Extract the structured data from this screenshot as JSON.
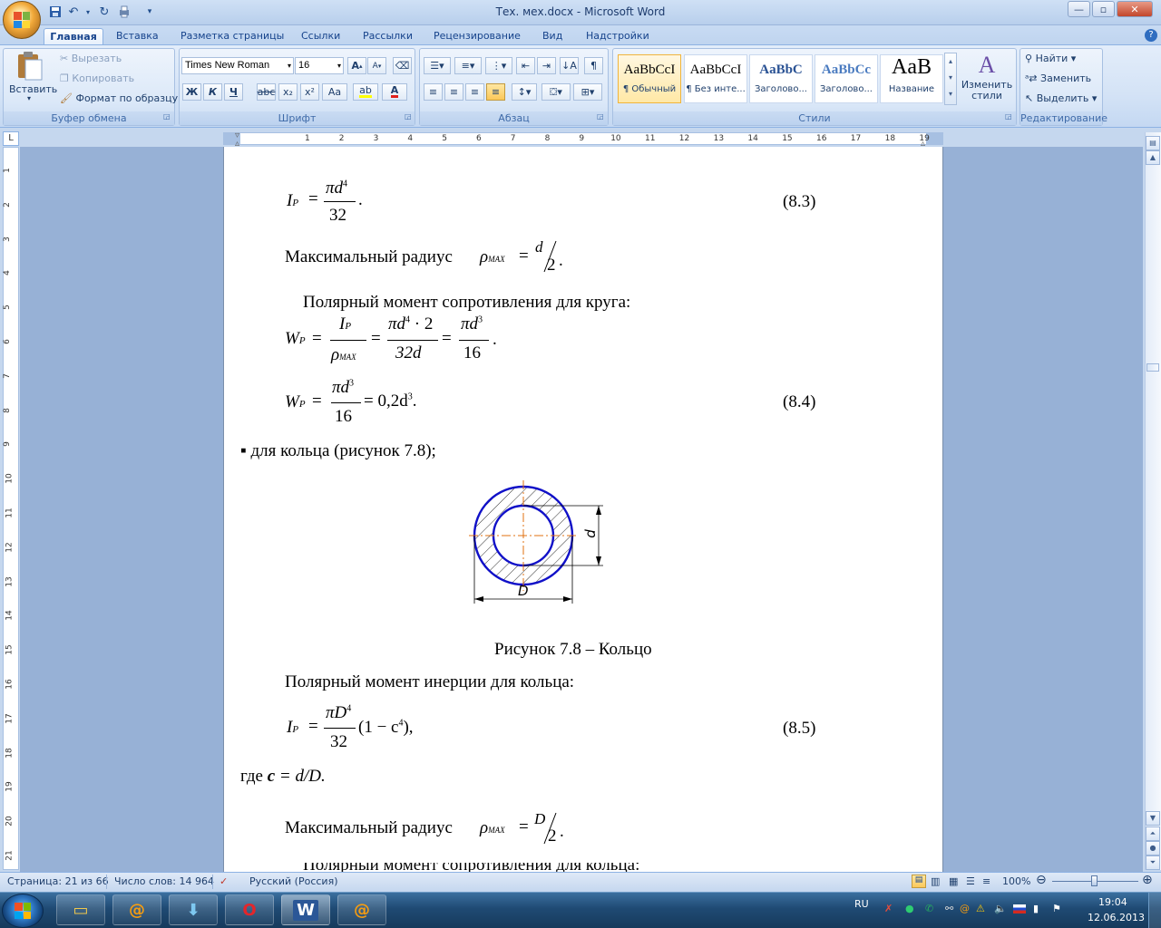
{
  "window": {
    "title": "Тех. мех.docx - Microsoft Word"
  },
  "tabs": [
    "Главная",
    "Вставка",
    "Разметка страницы",
    "Ссылки",
    "Рассылки",
    "Рецензирование",
    "Вид",
    "Надстройки"
  ],
  "clipboard": {
    "paste": "Вставить",
    "cut": "Вырезать",
    "copy": "Копировать",
    "format_painter": "Формат по образцу",
    "label": "Буфер обмена"
  },
  "font": {
    "name": "Times New Roman",
    "size": "16",
    "label": "Шрифт",
    "bold": "Ж",
    "italic": "К",
    "underline": "Ч",
    "strike": "abc",
    "subscript": "x₂",
    "superscript": "x²",
    "case": "Aa",
    "grow": "A",
    "shrink": "A"
  },
  "paragraph": {
    "label": "Абзац"
  },
  "styles": {
    "label": "Стили",
    "items": [
      {
        "sample": "AaBbCcI",
        "name": "¶ Обычный"
      },
      {
        "sample": "AaBbCcI",
        "name": "¶ Без инте..."
      },
      {
        "sample": "AaBbC",
        "name": "Заголово..."
      },
      {
        "sample": "AaBbCc",
        "name": "Заголово..."
      },
      {
        "sample": "AaB",
        "name": "Название"
      }
    ],
    "change": "Изменить стили"
  },
  "editing": {
    "find": "Найти",
    "replace": "Заменить",
    "select": "Выделить",
    "label": "Редактирование"
  },
  "ruler": {
    "h_numbers": [
      "1",
      "2",
      "3",
      "4",
      "5",
      "6",
      "7",
      "8",
      "9",
      "10",
      "11",
      "12",
      "13",
      "14",
      "15",
      "16",
      "17",
      "18",
      "19"
    ],
    "v_numbers": [
      "1",
      "2",
      "3",
      "4",
      "5",
      "6",
      "7",
      "8",
      "9",
      "10",
      "11",
      "12",
      "13",
      "14",
      "15",
      "16",
      "17",
      "18",
      "19",
      "20",
      "21"
    ]
  },
  "document": {
    "eq83_lhs": "I",
    "eq83_sub": "P",
    "eq83_num": "πd",
    "eq83_exp": "4",
    "eq83_den": "32",
    "eq83_tag": "(8.3)",
    "max_radius_label": "Максимальный радиус",
    "rho": "ρ",
    "rho_sub": "MAX",
    "r1_num": "d",
    "r1_den": "2",
    "polar_moment_circle": "Полярный момент сопротивления для круга:",
    "wp": "W",
    "wp_sub": "P",
    "w_num1": "I",
    "w_num1_sub": "P",
    "w_den1": "ρ",
    "w_den1_sub": "MAX",
    "w_num2": "πd",
    "w_num2_exp": "4",
    "w_num2_tail": " · 2",
    "w_den2": "32d",
    "w_num3": "πd",
    "w_num3_exp": "3",
    "w_den3": "16",
    "eq84_num": "πd",
    "eq84_exp": "3",
    "eq84_den": "16",
    "eq84_rhs": "= 0,2d",
    "eq84_rhs_exp": "3",
    "eq84_tag": "(8.4)",
    "ring_bullet": "▪ для кольца (рисунок 7.8);",
    "fig_label_d": "d",
    "fig_label_D": "D",
    "fig_caption": "Рисунок 7.8 – Кольцо",
    "polar_inertia_ring": "Полярный момент инерции для кольца:",
    "eq85_num": "πD",
    "eq85_exp": "4",
    "eq85_den": "32",
    "eq85_tail": "(1 − c",
    "eq85_tail_exp": "4",
    "eq85_end": "),",
    "eq85_tag": "(8.5)",
    "where_prefix": "где ",
    "where_c": "c",
    "where_rest": " = d/D.",
    "r2_num": "D",
    "r2_den": "2",
    "cut_line": "Полярный момент сопротивления для кольца:"
  },
  "status": {
    "page": "Страница: 21 из 66",
    "words": "Число слов: 14 964",
    "language": "Русский (Россия)",
    "zoom": "100%"
  },
  "tray": {
    "lang": "RU",
    "time": "19:04",
    "date": "12.06.2013"
  },
  "colors": {
    "ring": "#1010c8",
    "centerline": "#e07010",
    "accent": "#15428b"
  }
}
